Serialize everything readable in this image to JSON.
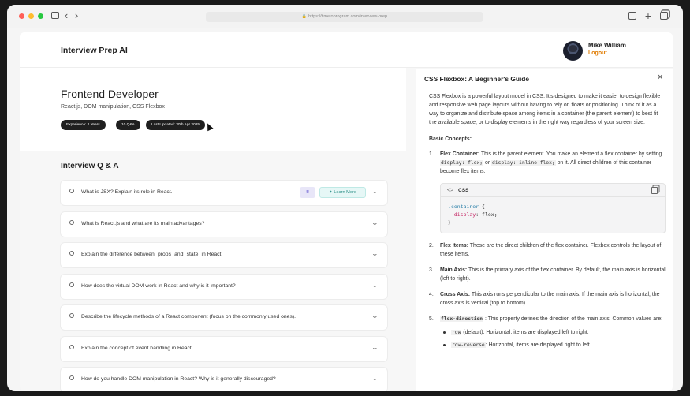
{
  "browser": {
    "url": "https://timetoprogram.com/interview-prep"
  },
  "header": {
    "brand": "Interview Prep AI",
    "user_name": "Mike William",
    "logout_label": "Logout"
  },
  "hero": {
    "title": "Frontend Developer",
    "subtitle": "React.js, DOM manipulation, CSS Flexbox",
    "pills": [
      "Experience: 2 Years",
      "10 Q&A",
      "Last Updated: 30th Apr 2025"
    ]
  },
  "qa": {
    "heading": "Interview Q & A",
    "learn_more_label": "Learn More",
    "questions": [
      "What is JSX? Explain its role in React.",
      "What is React.js and what are its main advantages?",
      "Explain the difference between `props` and `state` in React.",
      "How does the virtual DOM work in React and why is it important?",
      "Describe the lifecycle methods of a React component (focus on the commonly used ones).",
      "Explain the concept of event handling in React.",
      "How do you handle DOM manipulation in React? Why is it generally discouraged?"
    ]
  },
  "panel": {
    "title": "CSS Flexbox: A Beginner's Guide",
    "intro": "CSS Flexbox is a powerful layout model in CSS. It's designed to make it easier to design flexible and responsive web page layouts without having to rely on floats or positioning. Think of it as a way to organize and distribute space among items in a container (the parent element) to best fit the available space, or to display elements in the right way regardless of your screen size.",
    "basic_heading": "Basic Concepts:",
    "item1": {
      "num": "1.",
      "term": "Flex Container:",
      "text_a": " This is the parent element. You make an element a flex container by setting ",
      "code_a": "display: flex;",
      "text_b": " or ",
      "code_b": "display: inline-flex;",
      "text_c": " on it. All direct children of this container become flex items."
    },
    "code": {
      "lang": "CSS",
      "line1_sel": ".container",
      "line1_rest": " {",
      "line2_prop": "  display",
      "line2_rest": ": flex;",
      "line3": "}"
    },
    "item2": {
      "num": "2.",
      "term": "Flex Items:",
      "text": " These are the direct children of the flex container. Flexbox controls the layout of these items."
    },
    "item3": {
      "num": "3.",
      "term": "Main Axis:",
      "text": " This is the primary axis of the flex container. By default, the main axis is horizontal (left to right)."
    },
    "item4": {
      "num": "4.",
      "term": "Cross Axis:",
      "text": " This axis runs perpendicular to the main axis. If the main axis is horizontal, the cross axis is vertical (top to bottom)."
    },
    "item5": {
      "num": "5.",
      "term_code": "flex-direction",
      "text": " : This property defines the direction of the main axis. Common values are:",
      "sub": [
        {
          "code": "row",
          "text": " (default): Horizontal, items are displayed left to right."
        },
        {
          "code": "row-reverse",
          "text": ": Horizontal, items are displayed right to left."
        }
      ]
    }
  }
}
